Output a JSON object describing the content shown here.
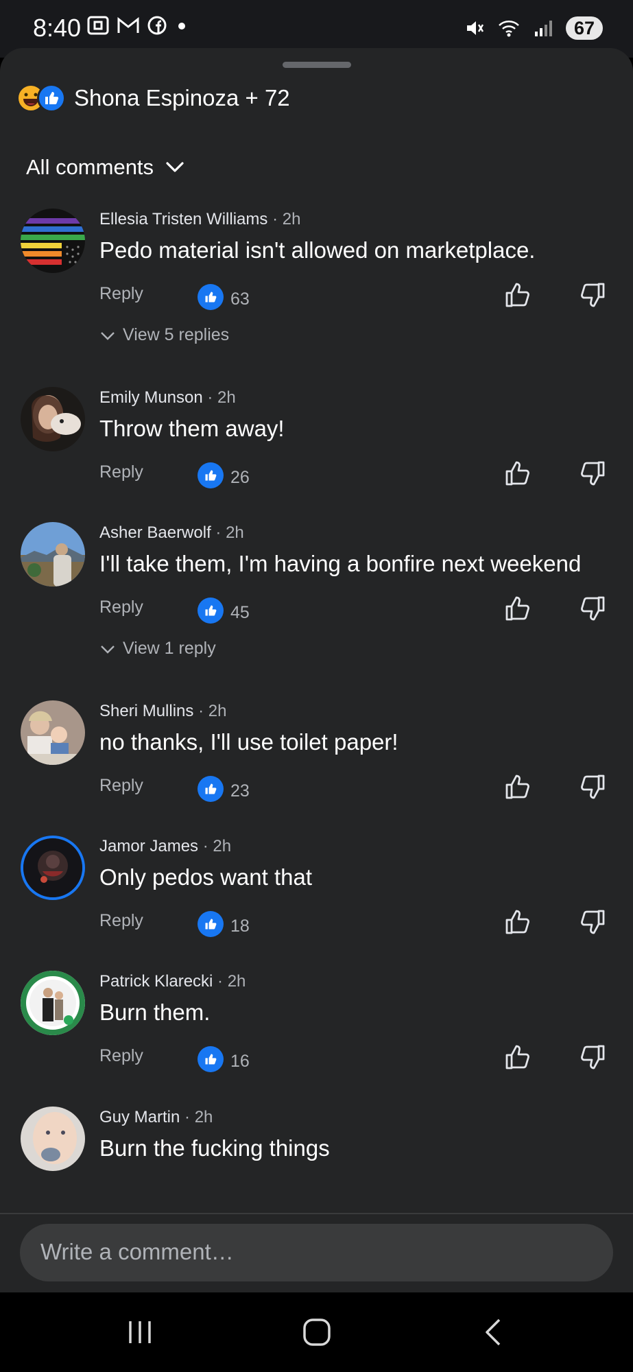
{
  "status_bar": {
    "time": "8:40",
    "battery": "67",
    "icons": [
      "screenshot-icon",
      "gmail-icon",
      "facebook-icon",
      "notification-dot-icon",
      "mute-icon",
      "wifi-icon",
      "signal-icon"
    ]
  },
  "header": {
    "reactions_text": "Shona Espinoza + 72",
    "reaction_icons": [
      "haha-reaction-icon",
      "like-reaction-icon"
    ],
    "filter_label": "All comments"
  },
  "comments": [
    {
      "name": "Ellesia Tristen Williams",
      "time": "· 2h",
      "text": "Pedo material isn't allowed on marketplace.",
      "reply": "Reply",
      "likes": "63",
      "replies_label": "View 5 replies"
    },
    {
      "name": "Emily Munson",
      "time": "· 2h",
      "text": "Throw them away!",
      "reply": "Reply",
      "likes": "26"
    },
    {
      "name": "Asher Baerwolf",
      "time": "· 2h",
      "text": "I'll take them, I'm having a bonfire next weekend",
      "reply": "Reply",
      "likes": "45",
      "replies_label": "View 1 reply"
    },
    {
      "name": "Sheri Mullins",
      "time": "· 2h",
      "text": "no thanks, I'll use toilet paper!",
      "reply": "Reply",
      "likes": "23"
    },
    {
      "name": "Jamor James",
      "time": "· 2h",
      "text": "Only pedos want that",
      "reply": "Reply",
      "likes": "18"
    },
    {
      "name": "Patrick Klarecki",
      "time": "· 2h",
      "text": "Burn them.",
      "reply": "Reply",
      "likes": "16"
    },
    {
      "name": "Guy Martin",
      "time": "· 2h",
      "text": "Burn the fucking things"
    }
  ],
  "composer": {
    "placeholder": "Write a comment…"
  },
  "colors": {
    "sheet_bg": "#242526",
    "accent": "#1877f2",
    "muted_text": "#b0b3b8"
  }
}
